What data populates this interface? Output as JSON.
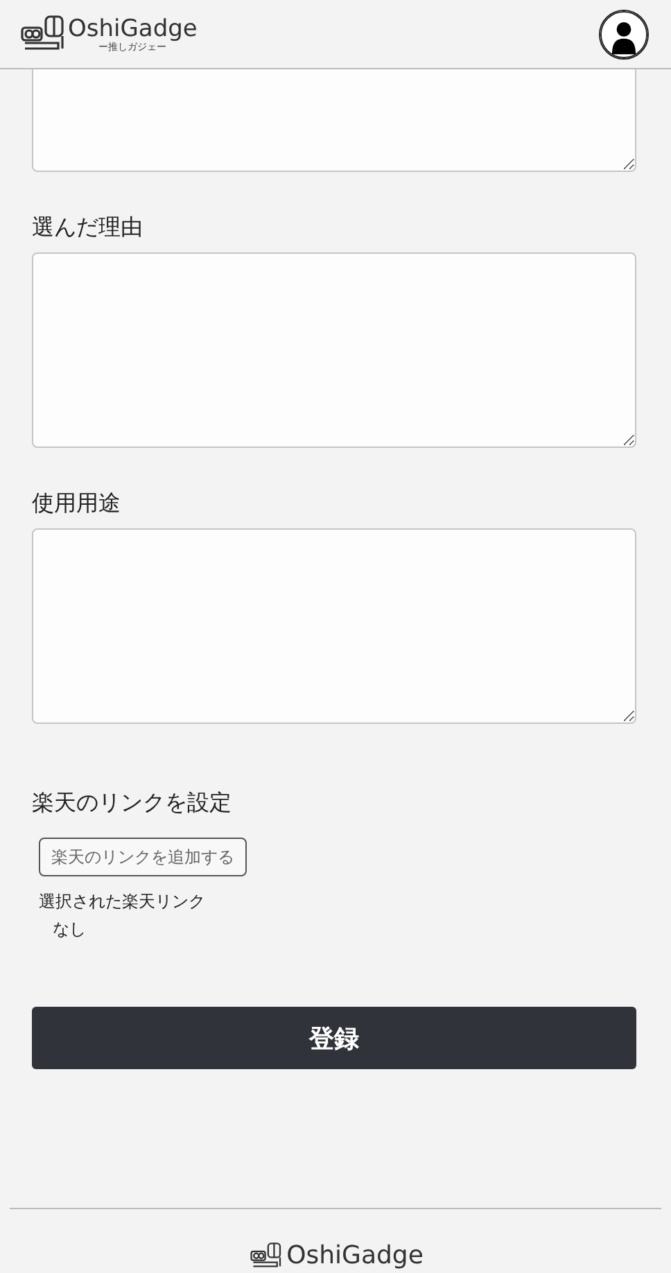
{
  "header": {
    "logo": {
      "name": "OshiGadge",
      "tagline": "ー推しガジェー"
    }
  },
  "form": {
    "fields": [
      {
        "label": "選んだ理由"
      },
      {
        "label": "使用用途"
      }
    ],
    "rakuten": {
      "label": "楽天のリンクを設定",
      "button": "楽天のリンクを追加する",
      "selected_label": "選択された楽天リンク",
      "selected_value": "なし"
    },
    "submit": "登録"
  },
  "footer": {
    "logo": {
      "name": "OshiGadge"
    }
  }
}
